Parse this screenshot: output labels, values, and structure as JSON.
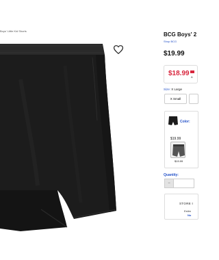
{
  "breadcrumb": "Boys' Little Kid Shorts",
  "product": {
    "title": "BCG Boys' 2",
    "shop_link": "Shop BCG",
    "price": "$19.99",
    "sale_price": "$18.99",
    "sale_note": "A",
    "brand_mark": "BCG"
  },
  "size": {
    "label": "Size:",
    "selected": "X Large",
    "options": [
      "X Small",
      ""
    ]
  },
  "color": {
    "label": "Color:",
    "swatches": [
      {
        "price": "$19.99"
      },
      {
        "price": "$19.99"
      }
    ]
  },
  "quantity": {
    "label": "Quantity:",
    "minus": "−"
  },
  "store": {
    "title": "STORE I",
    "line1": "Estim",
    "line2": "No"
  },
  "icons": {
    "wishlist": "heart-icon"
  },
  "colors": {
    "accent_blue": "#2250c8",
    "sale_red": "#d8253d",
    "product_black": "#1c1c1c"
  }
}
